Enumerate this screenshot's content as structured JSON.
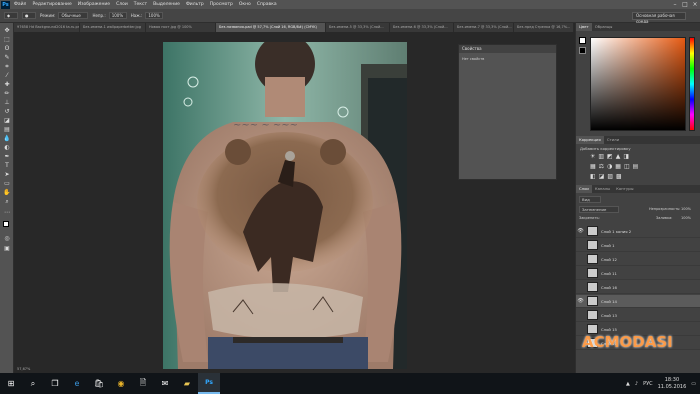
{
  "menubar": {
    "logo": "Ps",
    "items": [
      "Файл",
      "Редактирование",
      "Изображение",
      "Слои",
      "Текст",
      "Выделение",
      "Фильтр",
      "Просмотр",
      "Окно",
      "Справка"
    ],
    "window_controls": [
      "–",
      "□",
      "×"
    ]
  },
  "options_bar": {
    "mode_label": "Режим:",
    "mode_value": "Обычные",
    "opacity_label": "Непр.:",
    "opacity_value": "100%",
    "flow_label": "Наж.:",
    "flow_value": "100%",
    "workspace": "Основная рабочая среда"
  },
  "tabs": [
    {
      "label": "97658 Hd Background2016 ta.ru.png @ 1...",
      "active": false
    },
    {
      "label": "Без-имени-1 wallpaperbetter.jpg",
      "active": false
    },
    {
      "label": "Новая пост.jpg @ 100%",
      "active": false
    },
    {
      "label": "Без-названия-pad @ 57,7% (Слой 16, RGB/8#) (CMYK)",
      "active": true
    },
    {
      "label": "Без-имени-5 @ 33,3% (Слой...",
      "active": false
    },
    {
      "label": "Без-имени-6 @ 33,3% (Слой...",
      "active": false
    },
    {
      "label": "Без-имени-7 @ 33,3% (Слой...",
      "active": false
    },
    {
      "label": "Без-пред Стрелка @ 16,7%...",
      "active": false
    }
  ],
  "properties_panel": {
    "title": "Свойства",
    "subtitle": "Нет свойств"
  },
  "right_panel": {
    "color_tabs": [
      "Цвет",
      "Образцы"
    ],
    "adjust_tabs": [
      "Коррекция",
      "Стили"
    ],
    "adjust_label": "Добавить корректировку",
    "layers_tabs": [
      "Слои",
      "Каналы",
      "Контуры"
    ],
    "filter_label": "Вид",
    "blend_mode": "Затемнение",
    "opacity_label": "Непрозрачность:",
    "opacity_value": "100%",
    "lock_label": "Закрепить:",
    "fill_label": "Заливка:",
    "fill_value": "100%",
    "layers": [
      {
        "name": "Слой 1 копия 2",
        "visible": true,
        "active": false
      },
      {
        "name": "Слой 1",
        "visible": false,
        "active": false
      },
      {
        "name": "Слой 12",
        "visible": false,
        "active": false
      },
      {
        "name": "Слой 11",
        "visible": false,
        "active": false
      },
      {
        "name": "Слой 16",
        "visible": false,
        "active": false
      },
      {
        "name": "Слой 14",
        "visible": true,
        "active": true
      },
      {
        "name": "Слой 13",
        "visible": false,
        "active": false
      },
      {
        "name": "Слой 15",
        "visible": false,
        "active": false
      },
      {
        "name": "Слой 10",
        "visible": false,
        "active": false
      }
    ]
  },
  "status_bar": {
    "zoom": "57,67%"
  },
  "taskbar": {
    "apps": [
      "start-icon",
      "search-icon",
      "task-view-icon",
      "edge-icon",
      "store-icon",
      "chrome-icon",
      "files-icon",
      "mail-icon",
      "folder-icon",
      "photoshop-icon"
    ],
    "lang": "РУС",
    "time": "18:30",
    "date": "11.05.2016"
  },
  "watermark": "ACMODASI",
  "colors": {
    "accent": "#31a8ff",
    "panel": "#535353",
    "bg": "#282828"
  }
}
